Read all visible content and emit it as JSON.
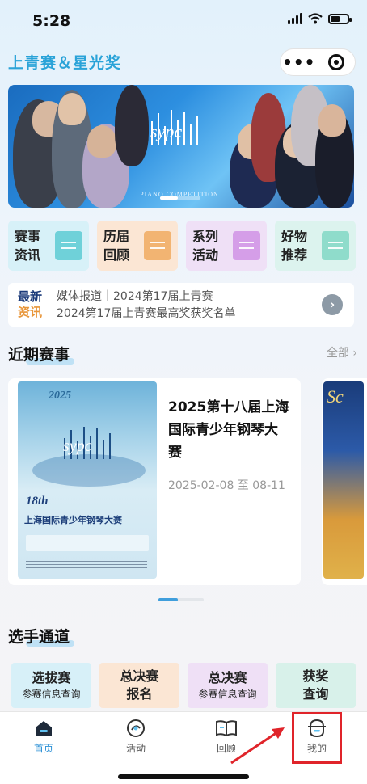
{
  "status_bar": {
    "time": "5:28",
    "battery_level": 0.55
  },
  "header": {
    "app_title": "上青赛＆星光奖",
    "more_icon": "ellipsis-icon",
    "close_icon": "target-icon"
  },
  "banner": {
    "competition_text": "PIANO COMPETITION",
    "icon": "sypc-logo"
  },
  "quick_links": [
    {
      "label": "赛事资讯",
      "color": "#d7f1f8",
      "icon_color": "#6fd1d9"
    },
    {
      "label": "历届回顾",
      "color": "#fbe6d4",
      "icon_color": "#f2b472"
    },
    {
      "label": "系列活动",
      "color": "#efe0f6",
      "icon_color": "#d59ee8"
    },
    {
      "label": "好物推荐",
      "color": "#dcf3ee",
      "icon_color": "#8fdccb"
    }
  ],
  "news": {
    "tag_line1": "最新",
    "tag_line2": "资讯",
    "line1": "媒体报道｜2024第17届上青赛",
    "line2": "2024第17届上青赛最高奖获奖名单",
    "arrow_icon": "chevron-right-icon"
  },
  "recent": {
    "title": "近期赛事",
    "all_label": "全部",
    "events": [
      {
        "title": "2025第十八届上海国际青少年钢琴大赛",
        "date": "2025-02-08 至 08-11",
        "poster_year": "2025",
        "poster_number": "18th",
        "poster_title": "上海国际青少年钢琴大赛"
      }
    ],
    "second_poster_text": "Sc"
  },
  "channel": {
    "title": "选手通道",
    "entries": [
      {
        "line1": "选拔赛",
        "line2": "参赛信息查询",
        "color": "#d7f0f8"
      },
      {
        "line1": "总决赛",
        "line2": "报名",
        "color": "#fbe6d4"
      },
      {
        "line1": "总决赛",
        "line2": "参赛信息查询",
        "color": "#efe0f6"
      },
      {
        "line1": "获奖",
        "line2": "查询",
        "color": "#d8f1ea"
      }
    ]
  },
  "tabbar": {
    "tabs": [
      {
        "label": "首页",
        "icon": "home-icon",
        "active": true
      },
      {
        "label": "活动",
        "icon": "activity-icon",
        "active": false
      },
      {
        "label": "回顾",
        "icon": "book-icon",
        "active": false
      },
      {
        "label": "我的",
        "icon": "profile-icon",
        "active": false
      }
    ]
  }
}
